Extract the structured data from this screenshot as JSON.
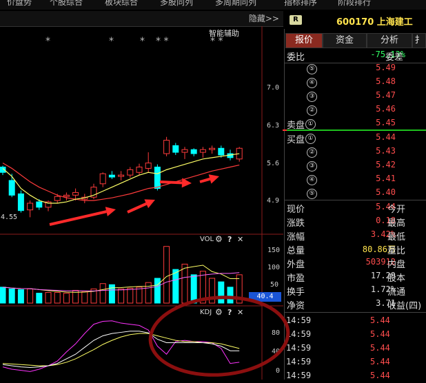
{
  "menu": [
    "价盘势",
    "个股综合",
    "板块综合",
    "多股同列",
    "多周期同列",
    "指标排序",
    "阶段排行"
  ],
  "chart": {
    "hide_label": "隐藏>>",
    "assist_label": "智能辅助",
    "stars": [
      "*",
      "*",
      "*",
      "* *",
      "* *"
    ],
    "price_axis": [
      "7.0",
      "6.3",
      "5.6",
      "4.9"
    ],
    "low_price_label": "4.55",
    "vol_label": "VOL",
    "vol_axis": [
      "150",
      "100",
      "50"
    ],
    "vol_current": "40.4",
    "kdj_label": "KDJ",
    "kdj_axis": [
      "80",
      "40",
      "0"
    ],
    "gear_icon": "⚙",
    "help_icon": "?",
    "close_icon": "✕",
    "colors": {
      "up": "#ff3b3b",
      "down": "#00ffff",
      "ma1": "#ffff66",
      "ma2": "#ff3b3b",
      "kdj_j": "#ff33ff",
      "annotation": "#ff2a2a"
    }
  },
  "chart_data": {
    "type": "candlestick",
    "candles": [
      {
        "o": 5.3,
        "h": 5.32,
        "l": 5.18,
        "c": 5.22
      },
      {
        "o": 5.1,
        "h": 5.2,
        "l": 4.85,
        "c": 4.88
      },
      {
        "o": 4.9,
        "h": 4.95,
        "l": 4.62,
        "c": 4.65
      },
      {
        "o": 4.66,
        "h": 4.8,
        "l": 4.55,
        "c": 4.76
      },
      {
        "o": 4.78,
        "h": 4.82,
        "l": 4.66,
        "c": 4.7
      },
      {
        "o": 4.7,
        "h": 4.8,
        "l": 4.64,
        "c": 4.78
      },
      {
        "o": 4.8,
        "h": 4.9,
        "l": 4.76,
        "c": 4.86
      },
      {
        "o": 4.86,
        "h": 4.92,
        "l": 4.8,
        "c": 4.88
      },
      {
        "o": 4.88,
        "h": 4.98,
        "l": 4.8,
        "c": 4.92
      },
      {
        "o": 4.82,
        "h": 4.9,
        "l": 4.76,
        "c": 4.85
      },
      {
        "o": 4.85,
        "h": 5.05,
        "l": 4.82,
        "c": 5.0
      },
      {
        "o": 5.05,
        "h": 5.22,
        "l": 5.0,
        "c": 5.2
      },
      {
        "o": 5.18,
        "h": 5.24,
        "l": 5.12,
        "c": 5.15
      },
      {
        "o": 5.16,
        "h": 5.24,
        "l": 5.1,
        "c": 5.18
      },
      {
        "o": 5.18,
        "h": 5.3,
        "l": 5.14,
        "c": 5.26
      },
      {
        "o": 5.22,
        "h": 5.35,
        "l": 5.18,
        "c": 5.3
      },
      {
        "o": 5.28,
        "h": 5.52,
        "l": 5.22,
        "c": 5.36
      },
      {
        "o": 5.3,
        "h": 5.34,
        "l": 4.95,
        "c": 4.98
      },
      {
        "o": 5.5,
        "h": 5.75,
        "l": 5.46,
        "c": 5.7
      },
      {
        "o": 5.62,
        "h": 5.66,
        "l": 5.48,
        "c": 5.52
      },
      {
        "o": 5.52,
        "h": 5.6,
        "l": 5.42,
        "c": 5.56
      },
      {
        "o": 5.56,
        "h": 5.58,
        "l": 5.46,
        "c": 5.5
      },
      {
        "o": 5.52,
        "h": 5.6,
        "l": 5.44,
        "c": 5.56
      },
      {
        "o": 5.56,
        "h": 5.62,
        "l": 5.5,
        "c": 5.58
      },
      {
        "o": 5.58,
        "h": 5.62,
        "l": 5.44,
        "c": 5.48
      },
      {
        "o": 5.5,
        "h": 5.56,
        "l": 5.4,
        "c": 5.44
      },
      {
        "o": 5.42,
        "h": 5.6,
        "l": 5.38,
        "c": 5.58
      }
    ],
    "ma_short": [
      5.28,
      5.16,
      4.98,
      4.88,
      4.8,
      4.76,
      4.76,
      4.78,
      4.82,
      4.84,
      4.88,
      4.94,
      5.0,
      5.06,
      5.12,
      5.18,
      5.22,
      5.2,
      5.26,
      5.3,
      5.34,
      5.38,
      5.42,
      5.44,
      5.46,
      5.48,
      5.5
    ],
    "ma_long": [
      5.36,
      5.28,
      5.18,
      5.08,
      5.0,
      4.94,
      4.88,
      4.84,
      4.82,
      4.8,
      4.8,
      4.82,
      4.84,
      4.87,
      4.9,
      4.94,
      4.98,
      5.0,
      5.04,
      5.08,
      5.12,
      5.16,
      5.2,
      5.24,
      5.27,
      5.3,
      5.33
    ],
    "volume": [
      45,
      40,
      38,
      40,
      28,
      30,
      30,
      28,
      36,
      32,
      40,
      55,
      52,
      40,
      42,
      45,
      58,
      70,
      160,
      95,
      110,
      80,
      90,
      70,
      60,
      45,
      80
    ],
    "kdj_k": [
      20,
      18,
      16,
      15,
      16,
      18,
      22,
      30,
      38,
      50,
      62,
      70,
      74,
      76,
      78,
      78,
      75,
      64,
      58,
      58,
      58,
      58,
      58,
      56,
      52,
      44,
      44
    ],
    "kdj_d": [
      22,
      21,
      20,
      19,
      18,
      18,
      20,
      24,
      30,
      38,
      46,
      55,
      62,
      68,
      72,
      74,
      74,
      70,
      66,
      62,
      60,
      60,
      58,
      58,
      56,
      52,
      48
    ],
    "kdj_j": [
      16,
      12,
      10,
      8,
      12,
      18,
      26,
      42,
      56,
      74,
      90,
      95,
      96,
      92,
      90,
      88,
      80,
      52,
      38,
      60,
      62,
      60,
      60,
      58,
      48,
      22,
      24
    ],
    "ylim": [
      4.4,
      7.3
    ],
    "vol_ylim": [
      0,
      175
    ],
    "kdj_ylim": [
      0,
      110
    ]
  },
  "quote": {
    "badge": "R",
    "title": "600170 上海建工",
    "tabs": [
      "报价",
      "资金",
      "分析",
      "扌"
    ],
    "weibi_label": "委比",
    "weibi_value": "-75.13%",
    "weicha_label": "委差",
    "sell_label": "卖盘",
    "buy_label": "买盘",
    "sell": [
      {
        "n": "⑤",
        "p": "5.49"
      },
      {
        "n": "④",
        "p": "5.48"
      },
      {
        "n": "③",
        "p": "5.47"
      },
      {
        "n": "②",
        "p": "5.46"
      },
      {
        "n": "①",
        "p": "5.45"
      }
    ],
    "buy": [
      {
        "n": "①",
        "p": "5.44"
      },
      {
        "n": "②",
        "p": "5.43"
      },
      {
        "n": "③",
        "p": "5.42"
      },
      {
        "n": "④",
        "p": "5.41"
      },
      {
        "n": "⑤",
        "p": "5.40"
      }
    ],
    "stats": [
      {
        "l": "现价",
        "v": "5.44",
        "r": "今开",
        "color": "#ff4d4d"
      },
      {
        "l": "涨跌",
        "v": "0.18",
        "r": "最高",
        "color": "#ff4d4d"
      },
      {
        "l": "涨幅",
        "v": "3.42%",
        "r": "最低",
        "color": "#ff4d4d"
      },
      {
        "l": "总量",
        "v": "80.86万",
        "r": "量比",
        "color": "#ffe34d"
      },
      {
        "l": "外盘",
        "v": "503912",
        "r": "内盘",
        "color": "#ff4d4d"
      },
      {
        "l": "市盈",
        "v": "17.29",
        "r": "股本",
        "color": "#dddddd"
      },
      {
        "l": "换手",
        "v": "1.72%",
        "r": "流通",
        "color": "#dddddd"
      },
      {
        "l": "净资",
        "v": "3.71",
        "r": "收益(四)",
        "color": "#dddddd"
      }
    ],
    "ticks": [
      {
        "t": "14:59",
        "p": "5.44"
      },
      {
        "t": "14:59",
        "p": "5.44"
      },
      {
        "t": "14:59",
        "p": "5.44"
      },
      {
        "t": "14:59",
        "p": "5.44"
      },
      {
        "t": "14:59",
        "p": "5.44"
      }
    ]
  }
}
